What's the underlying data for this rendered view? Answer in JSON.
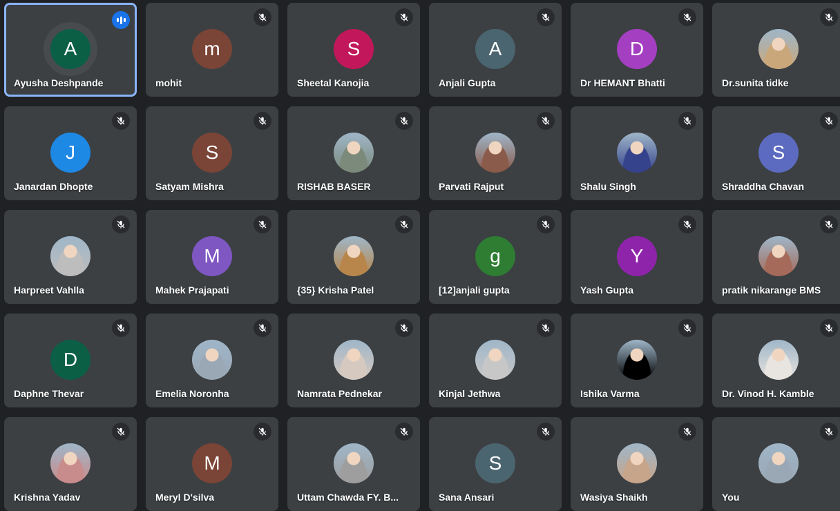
{
  "participants": [
    {
      "name": "Ayusha Deshpande",
      "initial": "A",
      "color": "#0b5f45",
      "speaking": true,
      "muted": false,
      "photo": false
    },
    {
      "name": "mohit",
      "initial": "m",
      "color": "#7a4436",
      "muted": true,
      "photo": false
    },
    {
      "name": "Sheetal Kanojia",
      "initial": "S",
      "color": "#c2185b",
      "muted": true,
      "photo": false
    },
    {
      "name": "Anjali Gupta",
      "initial": "A",
      "color": "#4b6570",
      "muted": true,
      "photo": false
    },
    {
      "name": "Dr HEMANT Bhatti",
      "initial": "D",
      "color": "#a53fc2",
      "muted": true,
      "photo": false
    },
    {
      "name": "Dr.sunita tidke",
      "initial": "",
      "color": "#c9a77a",
      "muted": true,
      "photo": true
    },
    {
      "name": "Janardan Dhopte",
      "initial": "J",
      "color": "#1e88e5",
      "muted": true,
      "photo": false
    },
    {
      "name": "Satyam Mishra",
      "initial": "S",
      "color": "#7a4436",
      "muted": true,
      "photo": false
    },
    {
      "name": "RISHAB BASER",
      "initial": "",
      "color": "#7b8a7a",
      "muted": true,
      "photo": true
    },
    {
      "name": "Parvati Rajput",
      "initial": "",
      "color": "#8a5a4a",
      "muted": true,
      "photo": true
    },
    {
      "name": "Shalu Singh",
      "initial": "",
      "color": "#35428c",
      "muted": true,
      "photo": true
    },
    {
      "name": "Shraddha Chavan",
      "initial": "S",
      "color": "#5c6bc0",
      "muted": true,
      "photo": false
    },
    {
      "name": "Harpreet Vahlla",
      "initial": "",
      "color": "#bdbdbd",
      "muted": true,
      "photo": true
    },
    {
      "name": "Mahek Prajapati",
      "initial": "M",
      "color": "#7e57c2",
      "muted": true,
      "photo": false
    },
    {
      "name": "{35} Krisha Patel",
      "initial": "",
      "color": "#b8864a",
      "muted": true,
      "photo": true
    },
    {
      "name": "[12]anjali gupta",
      "initial": "g",
      "color": "#2e7d32",
      "muted": true,
      "photo": false
    },
    {
      "name": "Yash Gupta",
      "initial": "Y",
      "color": "#8e24aa",
      "muted": true,
      "photo": false
    },
    {
      "name": "pratik nikarange BMS",
      "initial": "",
      "color": "#a56a5a",
      "muted": true,
      "photo": true
    },
    {
      "name": "Daphne Thevar",
      "initial": "D",
      "color": "#0b5f45",
      "muted": true,
      "photo": false
    },
    {
      "name": "Emelia Noronha",
      "initial": "",
      "color": "#9aa7b5",
      "muted": true,
      "photo": true
    },
    {
      "name": "Namrata Pednekar",
      "initial": "",
      "color": "#d6c9c0",
      "muted": true,
      "photo": true
    },
    {
      "name": "Kinjal Jethwa",
      "initial": "",
      "color": "#c7c7c7",
      "muted": true,
      "photo": true
    },
    {
      "name": "Ishika Varma",
      "initial": "",
      "color": "#000000",
      "muted": true,
      "photo": true
    },
    {
      "name": "Dr. Vinod H. Kamble",
      "initial": "",
      "color": "#e8e4df",
      "muted": true,
      "photo": true
    },
    {
      "name": "Krishna Yadav",
      "initial": "",
      "color": "#c98c8c",
      "muted": true,
      "photo": true
    },
    {
      "name": "Meryl D'silva",
      "initial": "M",
      "color": "#7a4436",
      "muted": true,
      "photo": false
    },
    {
      "name": "Uttam Chawda FY. B...",
      "initial": "",
      "color": "#9e9e9e",
      "muted": true,
      "photo": true
    },
    {
      "name": "Sana Ansari",
      "initial": "S",
      "color": "#4b6570",
      "muted": true,
      "photo": false
    },
    {
      "name": "Wasiya Shaikh",
      "initial": "",
      "color": "#c7a58a",
      "muted": true,
      "photo": true
    },
    {
      "name": "You",
      "initial": "",
      "color": "#9aa7b5",
      "muted": true,
      "photo": true
    }
  ],
  "icons": {
    "muted": "mic-off-icon",
    "speaking": "audio-level-icon"
  }
}
